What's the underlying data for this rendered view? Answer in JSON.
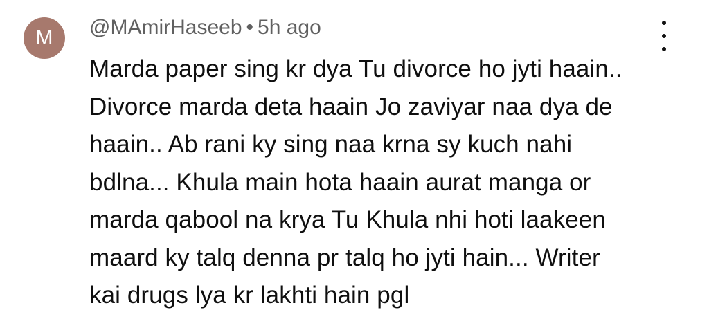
{
  "comment": {
    "avatar_letter": "M",
    "avatar_color": "#a7796d",
    "author": "@MAmirHaseeb",
    "separator": "•",
    "time": "5h ago",
    "lines": [
      "Marda paper sing kr dya Tu divorce ho jyti haain..",
      "Divorce marda deta haain Jo zaviyar naa dya de",
      "haain.. Ab rani ky sing naa krna sy kuch nahi",
      "bdlna... Khula main hota haain aurat manga or",
      "marda qabool na krya Tu Khula nhi hoti laakeen",
      "maard ky talq denna pr talq ho jyti hain... Writer",
      "kai drugs lya kr lakhti hain pgl"
    ],
    "menu_icon": "more-vert-icon"
  }
}
